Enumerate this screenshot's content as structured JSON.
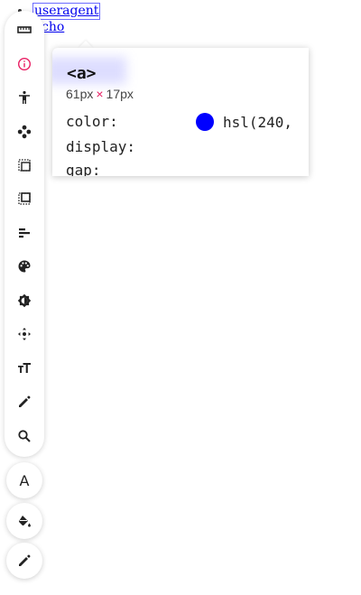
{
  "page": {
    "link_useragent": "useragent",
    "link_echo": "echo",
    "link_echo_visible": "cho"
  },
  "toolbar": {
    "tools": [
      {
        "name": "ruler-icon"
      },
      {
        "name": "info-icon",
        "active": true
      },
      {
        "name": "accessibility-icon"
      },
      {
        "name": "move-icon"
      },
      {
        "name": "margin-icon"
      },
      {
        "name": "padding-icon"
      },
      {
        "name": "align-icon"
      },
      {
        "name": "palette-icon"
      },
      {
        "name": "contrast-icon"
      },
      {
        "name": "position-icon"
      },
      {
        "name": "font-size-icon"
      },
      {
        "name": "edit-text-icon"
      },
      {
        "name": "search-icon"
      }
    ],
    "fabs": [
      {
        "name": "font-button",
        "label": "A"
      },
      {
        "name": "fill-button"
      },
      {
        "name": "pencil-button"
      }
    ]
  },
  "inspector": {
    "tag": "<a>",
    "width": "61px",
    "times": "×",
    "height": "17px",
    "props": [
      {
        "name": "color:",
        "value": "hsl(240,"
      },
      {
        "name": "display:",
        "value": ""
      },
      {
        "name": "gap:",
        "value": ""
      }
    ]
  },
  "colors": {
    "accent": "#e91e63",
    "link": "#0000ee",
    "swatch": "#0000ff"
  }
}
